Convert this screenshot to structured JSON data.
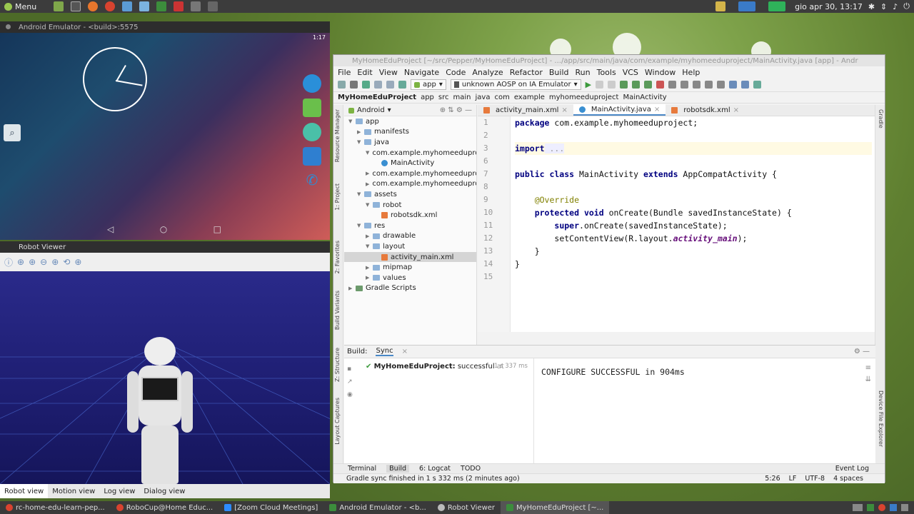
{
  "top_panel": {
    "menu_label": "Menu",
    "datetime": "gio apr 30, 13:17"
  },
  "emulator": {
    "title": "Android Emulator - <build>:5575",
    "status_time": "1:17"
  },
  "robot_viewer": {
    "title": "Robot Viewer",
    "tabs": [
      "Robot view",
      "Motion view",
      "Log view",
      "Dialog view"
    ]
  },
  "ide": {
    "title": "MyHomeEduProject [~/src/Pepper/MyHomeEduProject] - .../app/src/main/java/com/example/myhomeeduproject/MainActivity.java [app] - Andr",
    "menu": [
      "File",
      "Edit",
      "View",
      "Navigate",
      "Code",
      "Analyze",
      "Refactor",
      "Build",
      "Run",
      "Tools",
      "VCS",
      "Window",
      "Help"
    ],
    "run_module": "app",
    "run_device": "unknown AOSP on IA Emulator",
    "breadcrumb": [
      "MyHomeEduProject",
      "app",
      "src",
      "main",
      "java",
      "com",
      "example",
      "myhomeeduproject",
      "MainActivity"
    ],
    "project_view": "Android",
    "tree": [
      {
        "label": "app",
        "depth": 0,
        "kind": "folder",
        "arrow": "▼"
      },
      {
        "label": "manifests",
        "depth": 1,
        "kind": "folder",
        "arrow": "▶"
      },
      {
        "label": "java",
        "depth": 1,
        "kind": "folder",
        "arrow": "▼"
      },
      {
        "label": "com.example.myhomeedupro",
        "depth": 2,
        "kind": "folder",
        "arrow": "▼"
      },
      {
        "label": "MainActivity",
        "depth": 3,
        "kind": "class",
        "arrow": ""
      },
      {
        "label": "com.example.myhomeedupro",
        "depth": 2,
        "kind": "folder",
        "arrow": "▶"
      },
      {
        "label": "com.example.myhomeedupro",
        "depth": 2,
        "kind": "folder",
        "arrow": "▶"
      },
      {
        "label": "assets",
        "depth": 1,
        "kind": "folder",
        "arrow": "▼"
      },
      {
        "label": "robot",
        "depth": 2,
        "kind": "folder",
        "arrow": "▼"
      },
      {
        "label": "robotsdk.xml",
        "depth": 3,
        "kind": "xml",
        "arrow": ""
      },
      {
        "label": "res",
        "depth": 1,
        "kind": "folder",
        "arrow": "▼"
      },
      {
        "label": "drawable",
        "depth": 2,
        "kind": "folder",
        "arrow": "▶"
      },
      {
        "label": "layout",
        "depth": 2,
        "kind": "folder",
        "arrow": "▼"
      },
      {
        "label": "activity_main.xml",
        "depth": 3,
        "kind": "xml",
        "arrow": "",
        "selected": true
      },
      {
        "label": "mipmap",
        "depth": 2,
        "kind": "folder",
        "arrow": "▶"
      },
      {
        "label": "values",
        "depth": 2,
        "kind": "folder",
        "arrow": "▶"
      },
      {
        "label": "Gradle Scripts",
        "depth": 0,
        "kind": "gradle",
        "arrow": "▶"
      }
    ],
    "editor_tabs": [
      {
        "label": "activity_main.xml",
        "active": false
      },
      {
        "label": "MainActivity.java",
        "active": true
      },
      {
        "label": "robotsdk.xml",
        "active": false
      }
    ],
    "left_tool_tabs": [
      "Resource Manager",
      "1: Project",
      "2: Favorites",
      "Build Variants",
      "Z: Structure",
      "Layout Captures"
    ],
    "right_tool_tabs": [
      "Gradle",
      "Device File Explorer"
    ],
    "build": {
      "label": "Build:",
      "tab": "Sync",
      "row_title": "MyHomeEduProject:",
      "row_status": "successful",
      "row_at": "at",
      "row_time": "1 s 337 ms",
      "output": "CONFIGURE SUCCESSFUL in 904ms"
    },
    "bottom_tabs": [
      "Terminal",
      "Build",
      "6: Logcat",
      "TODO"
    ],
    "event_log": "Event Log",
    "status_message": "Gradle sync finished in 1 s 332 ms (2 minutes ago)",
    "status_pos": "5:26",
    "status_lf": "LF",
    "status_enc": "UTF-8",
    "status_indent": "4 spaces"
  },
  "code": {
    "l1_kw": "package",
    "l1_rest": " com.example.myhomeeduproject;",
    "l3_kw": "import",
    "l3_fold": " ...",
    "l7_kw": "public class",
    "l7_name": " MainActivity ",
    "l7_ext": "extends",
    "l7_rest": " AppCompatActivity {",
    "l9_ann": "@Override",
    "l10_kw": "protected void",
    "l10_rest": " onCreate(Bundle savedInstanceState) {",
    "l11_kw": "super",
    "l11_rest": ".onCreate(savedInstanceState);",
    "l12_a": "setContentView(R.layout.",
    "l12_it": "activity_main",
    "l12_b": ");",
    "l13": "}",
    "l14": "}"
  },
  "taskbar": [
    "rc-home-edu-learn-pep...",
    "RoboCup@Home Educ...",
    "[Zoom Cloud Meetings]",
    "Android Emulator - <b...",
    "Robot Viewer",
    "MyHomeEduProject [~..."
  ]
}
